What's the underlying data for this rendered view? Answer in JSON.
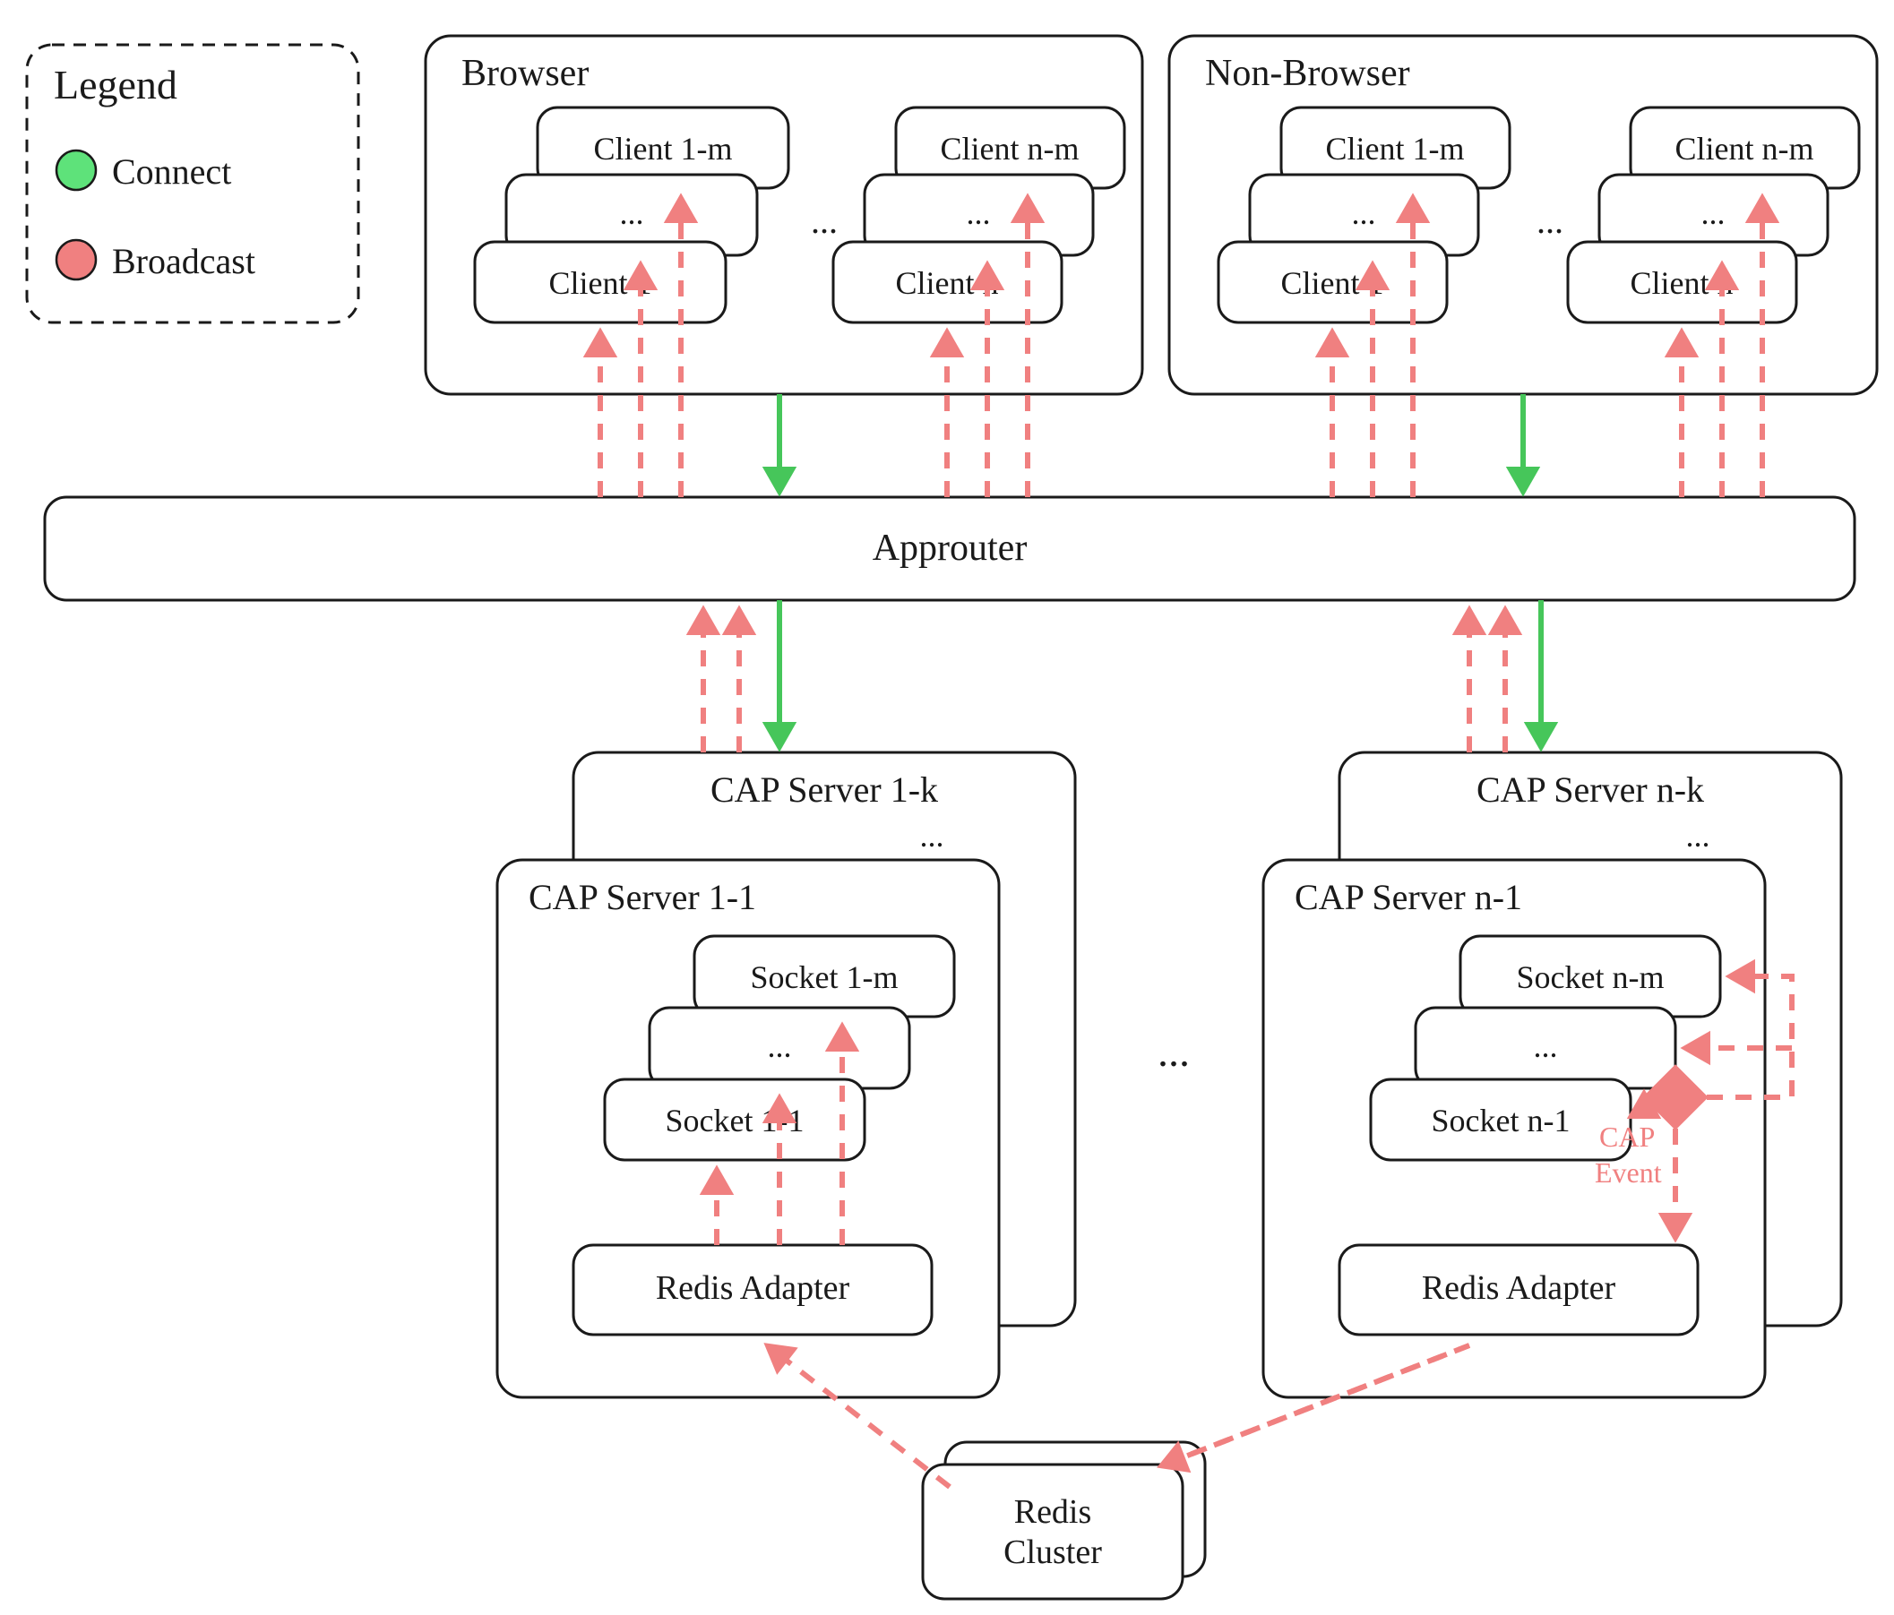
{
  "legend": {
    "title": "Legend",
    "items": {
      "connect": "Connect",
      "broadcast": "Broadcast"
    }
  },
  "browser": {
    "title": "Browser",
    "clientsA": {
      "top": "Client 1-m",
      "mid": "...",
      "bot": "Client 1"
    },
    "ellipsis": "...",
    "clientsB": {
      "top": "Client n-m",
      "mid": "...",
      "bot": "Client n"
    }
  },
  "nonbrowser": {
    "title": "Non-Browser",
    "clientsA": {
      "top": "Client 1-m",
      "mid": "...",
      "bot": "Client 1"
    },
    "ellipsis": "...",
    "clientsB": {
      "top": "Client n-m",
      "mid": "...",
      "bot": "Client n"
    }
  },
  "approuter": {
    "label": "Approuter"
  },
  "serversLeft": {
    "back": {
      "title": "CAP Server 1-k",
      "ellipsis": "..."
    },
    "front": {
      "title": "CAP Server 1-1",
      "sockets": {
        "top": "Socket 1-m",
        "mid": "...",
        "bot": "Socket 1-1"
      },
      "adapter": "Redis Adapter"
    }
  },
  "centerEllipsis": "...",
  "serversRight": {
    "back": {
      "title": "CAP Server n-k",
      "ellipsis": "..."
    },
    "front": {
      "title": "CAP Server n-1",
      "sockets": {
        "top": "Socket n-m",
        "mid": "...",
        "bot": "Socket n-1"
      },
      "adapter": "Redis Adapter"
    },
    "capEvent": {
      "line1": "CAP",
      "line2": "Event"
    }
  },
  "redis": {
    "label1": "Redis",
    "label2": "Cluster"
  }
}
